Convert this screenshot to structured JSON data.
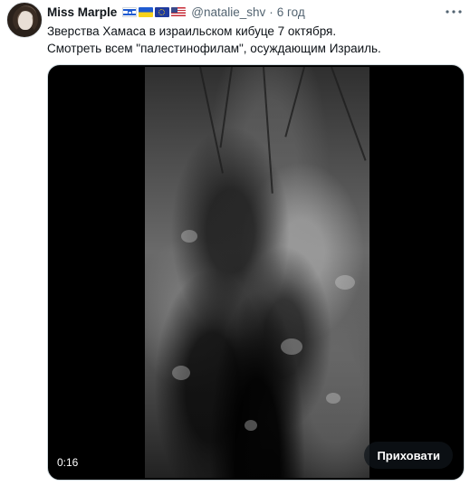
{
  "author": {
    "name": "Miss Marple",
    "handle": "@natalie_shv",
    "separator": "·",
    "time": "6 год",
    "flags": [
      "flag-israel-icon",
      "flag-ukraine-icon",
      "flag-eu-icon",
      "flag-usa-icon"
    ]
  },
  "more_icon": "more-options-icon",
  "tweet": {
    "line1": "Зверства Хамаса в израильском кибуце 7 октября.",
    "line2": "Смотреть всем \"палестинофилам\", осуждающим Израиль."
  },
  "video": {
    "timestamp": "0:16",
    "hide_label": "Приховати"
  },
  "colors": {
    "text_primary": "#0f1419",
    "text_secondary": "#536471",
    "media_background": "#000000",
    "button_background": "#0f1419"
  }
}
